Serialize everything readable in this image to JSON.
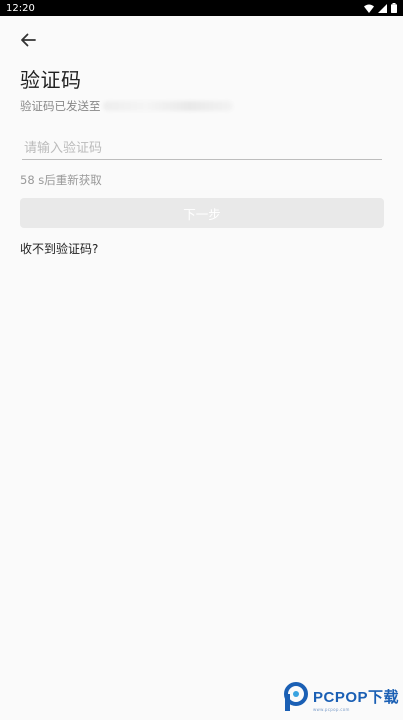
{
  "status_bar": {
    "time": "12:20"
  },
  "header": {
    "title": "验证码",
    "subtitle_prefix": "验证码已发送至"
  },
  "form": {
    "code_placeholder": "请输入验证码",
    "code_value": "",
    "resend_text": "58 s后重新获取",
    "next_label": "下一步",
    "no_code_label": "收不到验证码?"
  },
  "watermark": {
    "brand": "PCPOP下载",
    "sub": "www.pcpop.com"
  },
  "colors": {
    "accent": "#1a5fb4",
    "button_disabled": "#e9e9e9",
    "status_bar": "#000000"
  }
}
